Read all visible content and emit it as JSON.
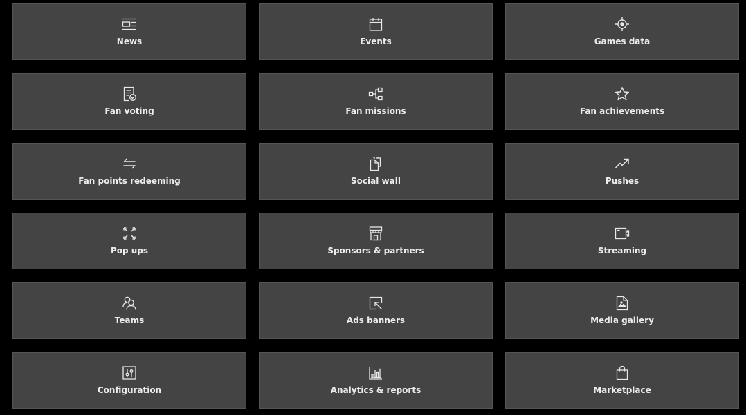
{
  "tiles": [
    {
      "id": "news",
      "label": "News",
      "icon": "news-icon"
    },
    {
      "id": "events",
      "label": "Events",
      "icon": "calendar-icon"
    },
    {
      "id": "games-data",
      "label": "Games data",
      "icon": "target-icon"
    },
    {
      "id": "fan-voting",
      "label": "Fan voting",
      "icon": "ballot-check-icon"
    },
    {
      "id": "fan-missions",
      "label": "Fan missions",
      "icon": "flowchart-icon"
    },
    {
      "id": "fan-achievements",
      "label": "Fan achievements",
      "icon": "star-icon"
    },
    {
      "id": "fan-points-redeeming",
      "label": "Fan points redeeming",
      "icon": "exchange-arrows-icon"
    },
    {
      "id": "social-wall",
      "label": "Social wall",
      "icon": "copy-documents-icon"
    },
    {
      "id": "pushes",
      "label": "Pushes",
      "icon": "trending-up-icon"
    },
    {
      "id": "pop-ups",
      "label": "Pop ups",
      "icon": "expand-arrows-icon"
    },
    {
      "id": "sponsors-partners",
      "label": "Sponsors & partners",
      "icon": "storefront-icon"
    },
    {
      "id": "streaming",
      "label": "Streaming",
      "icon": "video-camera-icon"
    },
    {
      "id": "teams",
      "label": "Teams",
      "icon": "people-icon"
    },
    {
      "id": "ads-banners",
      "label": "Ads banners",
      "icon": "cursor-box-icon"
    },
    {
      "id": "media-gallery",
      "label": "Media gallery",
      "icon": "image-file-icon"
    },
    {
      "id": "configuration",
      "label": "Configuration",
      "icon": "sliders-icon"
    },
    {
      "id": "analytics-reports",
      "label": "Analytics & reports",
      "icon": "bar-chart-icon"
    },
    {
      "id": "marketplace",
      "label": "Marketplace",
      "icon": "shopping-bag-icon"
    }
  ]
}
